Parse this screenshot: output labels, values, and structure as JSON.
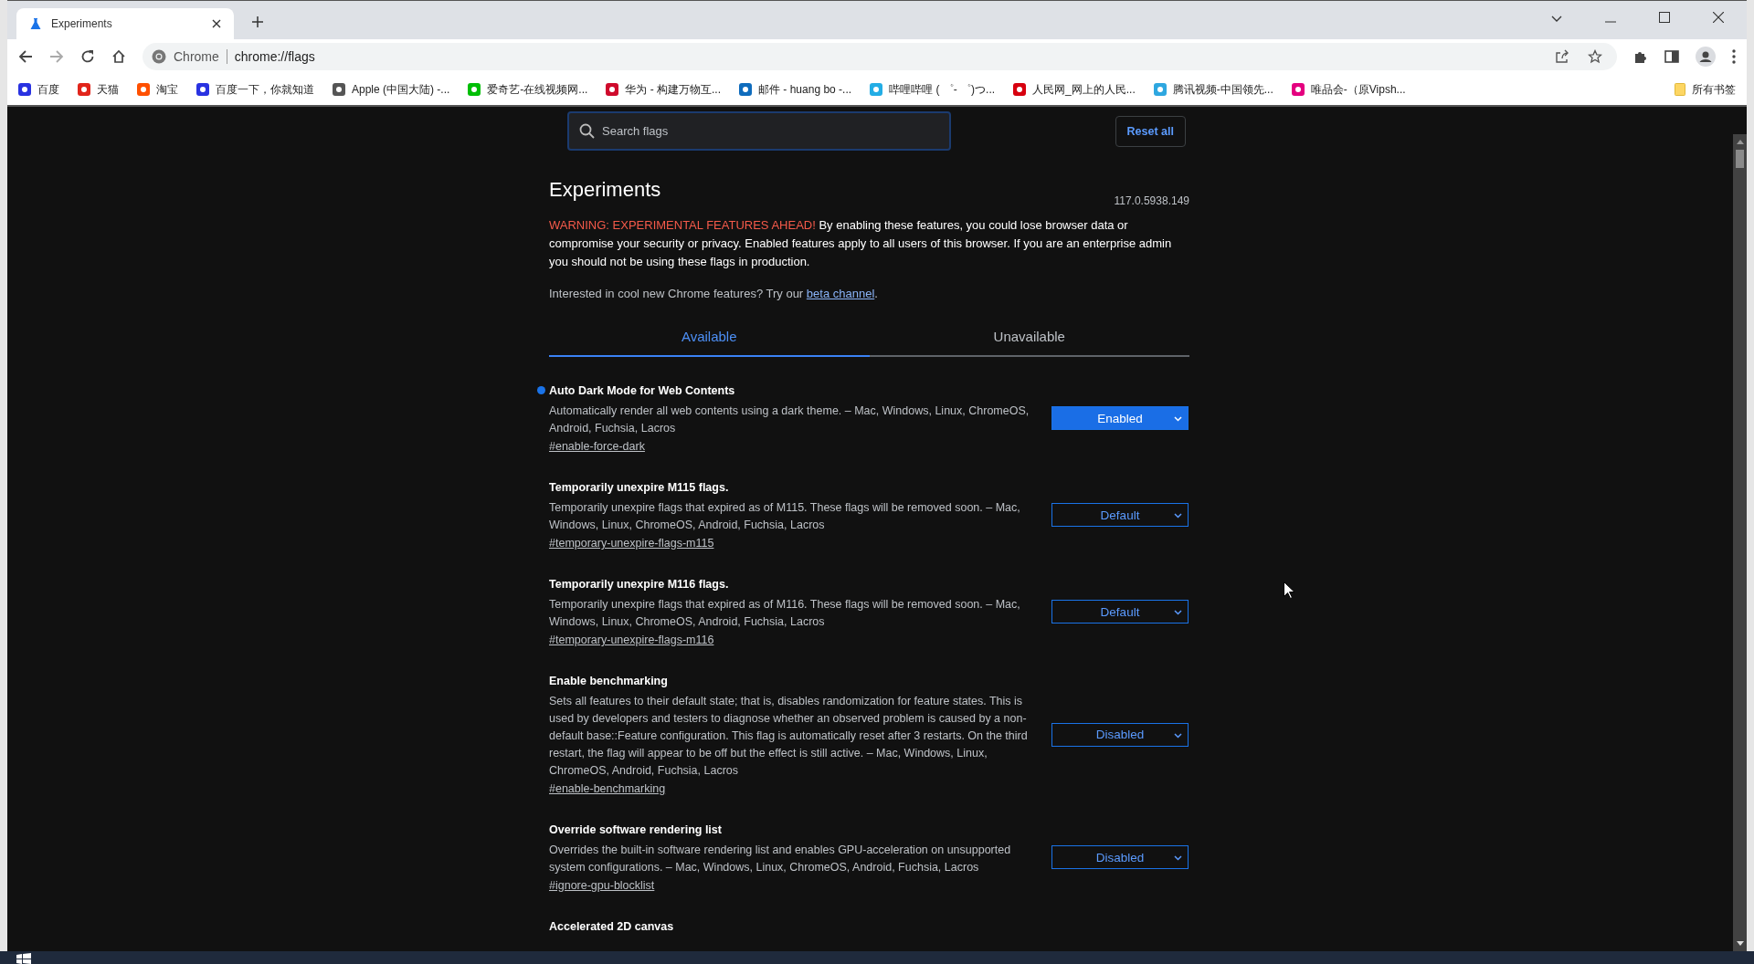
{
  "browser": {
    "tab": {
      "title": "Experiments"
    },
    "address": {
      "site": "Chrome",
      "url": "chrome://flags"
    },
    "bookmarks": [
      {
        "label": "百度"
      },
      {
        "label": "天猫"
      },
      {
        "label": "淘宝"
      },
      {
        "label": "百度一下，你就知道"
      },
      {
        "label": "Apple (中国大陆) -..."
      },
      {
        "label": "爱奇艺-在线视频网..."
      },
      {
        "label": "华为 - 构建万物互..."
      },
      {
        "label": "邮件 - huang bo -..."
      },
      {
        "label": "哔哩哔哩 ( ゜- ゜)つ..."
      },
      {
        "label": "人民网_网上的人民..."
      },
      {
        "label": "腾讯视频-中国领先..."
      },
      {
        "label": "唯品会-（原Vipsh..."
      }
    ],
    "all_bookmarks": "所有书签"
  },
  "page": {
    "search": {
      "placeholder": "Search flags"
    },
    "reset_button": "Reset all",
    "title": "Experiments",
    "version": "117.0.5938.149",
    "warning": {
      "highlight": "WARNING: EXPERIMENTAL FEATURES AHEAD!",
      "text": "By enabling these features, you could lose browser data or compromise your security or privacy. Enabled features apply to all users of this browser. If you are an enterprise admin you should not be using these flags in production."
    },
    "beta": {
      "text": "Interested in cool new Chrome features? Try our",
      "link": "beta channel",
      "end": "."
    },
    "tabs": [
      {
        "label": "Available",
        "selected": true
      },
      {
        "label": "Unavailable",
        "selected": false
      }
    ],
    "flags": [
      {
        "title": "Auto Dark Mode for Web Contents",
        "description": "Automatically render all web contents using a dark theme. – Mac, Windows, Linux, ChromeOS, Android, Fuchsia, Lacros",
        "link": "#enable-force-dark",
        "value": "Enabled",
        "modified": true
      },
      {
        "title": "Temporarily unexpire M115 flags.",
        "description": "Temporarily unexpire flags that expired as of M115. These flags will be removed soon. – Mac, Windows, Linux, ChromeOS, Android, Fuchsia, Lacros",
        "link": "#temporary-unexpire-flags-m115",
        "value": "Default",
        "modified": false
      },
      {
        "title": "Temporarily unexpire M116 flags.",
        "description": "Temporarily unexpire flags that expired as of M116. These flags will be removed soon. – Mac, Windows, Linux, ChromeOS, Android, Fuchsia, Lacros",
        "link": "#temporary-unexpire-flags-m116",
        "value": "Default",
        "modified": false
      },
      {
        "title": "Enable benchmarking",
        "description": "Sets all features to their default state; that is, disables randomization for feature states. This is used by developers and testers to diagnose whether an observed problem is caused by a non-default base::Feature configuration. This flag is automatically reset after 3 restarts. On the third restart, the flag will appear to be off but the effect is still active. – Mac, Windows, Linux, ChromeOS, Android, Fuchsia, Lacros",
        "link": "#enable-benchmarking",
        "value": "Disabled",
        "modified": false
      },
      {
        "title": "Override software rendering list",
        "description": "Overrides the built-in software rendering list and enables GPU-acceleration on unsupported system configurations. – Mac, Windows, Linux, ChromeOS, Android, Fuchsia, Lacros",
        "link": "#ignore-gpu-blocklist",
        "value": "Disabled",
        "modified": false
      },
      {
        "title": "Accelerated 2D canvas"
      }
    ]
  }
}
